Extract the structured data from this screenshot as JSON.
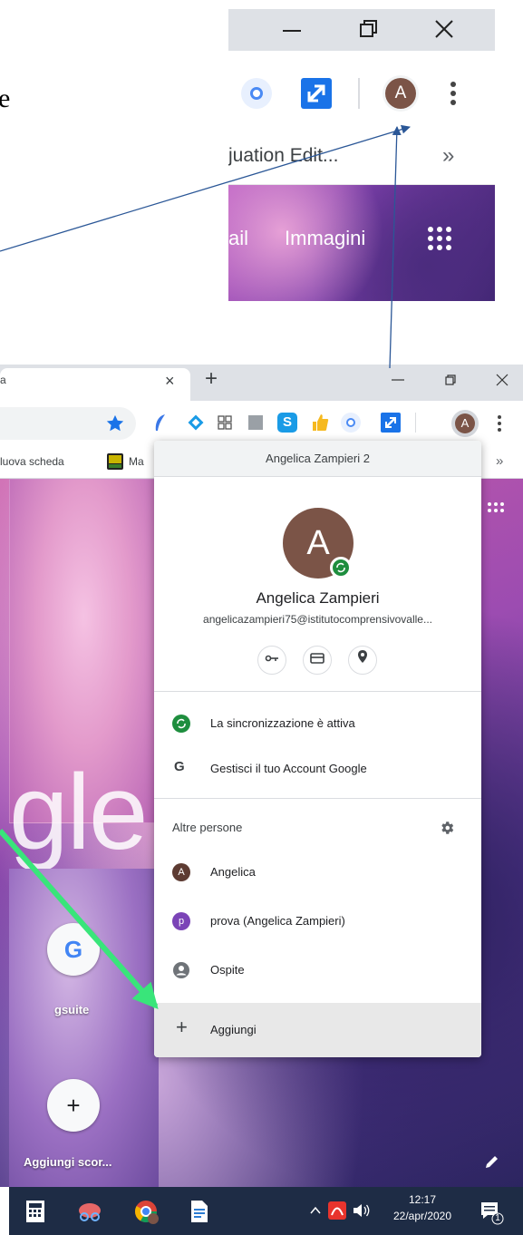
{
  "top_zoom": {
    "left_edge_char": "e",
    "avatar_letter": "A",
    "bookmark_text": "juation Edit...",
    "more_bookmarks": "»",
    "tab_gmail_fragment": "ail",
    "tab_images": "Immagini"
  },
  "browser": {
    "tab_fragment": "a",
    "tab_close": "×",
    "new_tab": "+",
    "bookmarks": [
      {
        "label": "luova scheda"
      },
      {
        "label": "Ma"
      }
    ],
    "bookmarks_more": "»",
    "avatar_letter": "A",
    "google_fragment": "gle",
    "shortcuts": [
      {
        "label": "gsuite"
      },
      {
        "label": "Aggiungi scor..."
      }
    ]
  },
  "profile_popup": {
    "header": "Angelica Zampieri 2",
    "avatar_letter": "A",
    "name": "Angelica Zampieri",
    "email": "angelicazampieri75@istitutocomprensivovalle...",
    "sync_text": "La sincronizzazione è attiva",
    "manage_text": "Gestisci il tuo Account Google",
    "manage_icon": "G",
    "other_people_label": "Altre persone",
    "people": [
      {
        "letter": "A",
        "name": "Angelica",
        "color": "#5d3b32"
      },
      {
        "letter": "p",
        "name": "prova (Angelica Zampieri)",
        "color": "#7b44b7"
      },
      {
        "letter": "",
        "name": "Ospite",
        "color": "#6f7378"
      }
    ],
    "add_icon": "+",
    "add_label": "Aggiungi"
  },
  "taskbar": {
    "time": "12:17",
    "date": "22/apr/2020",
    "notification_count": "1"
  },
  "colors": {
    "chrome_frame": "#dee1e6",
    "blue_accent": "#1a73e8",
    "arrow_blue": "#2b5797",
    "arrow_green": "#39e57a",
    "sync_green": "#1e8e3e",
    "avatar_brown": "#7b5447",
    "taskbar": "#1e2c45"
  }
}
